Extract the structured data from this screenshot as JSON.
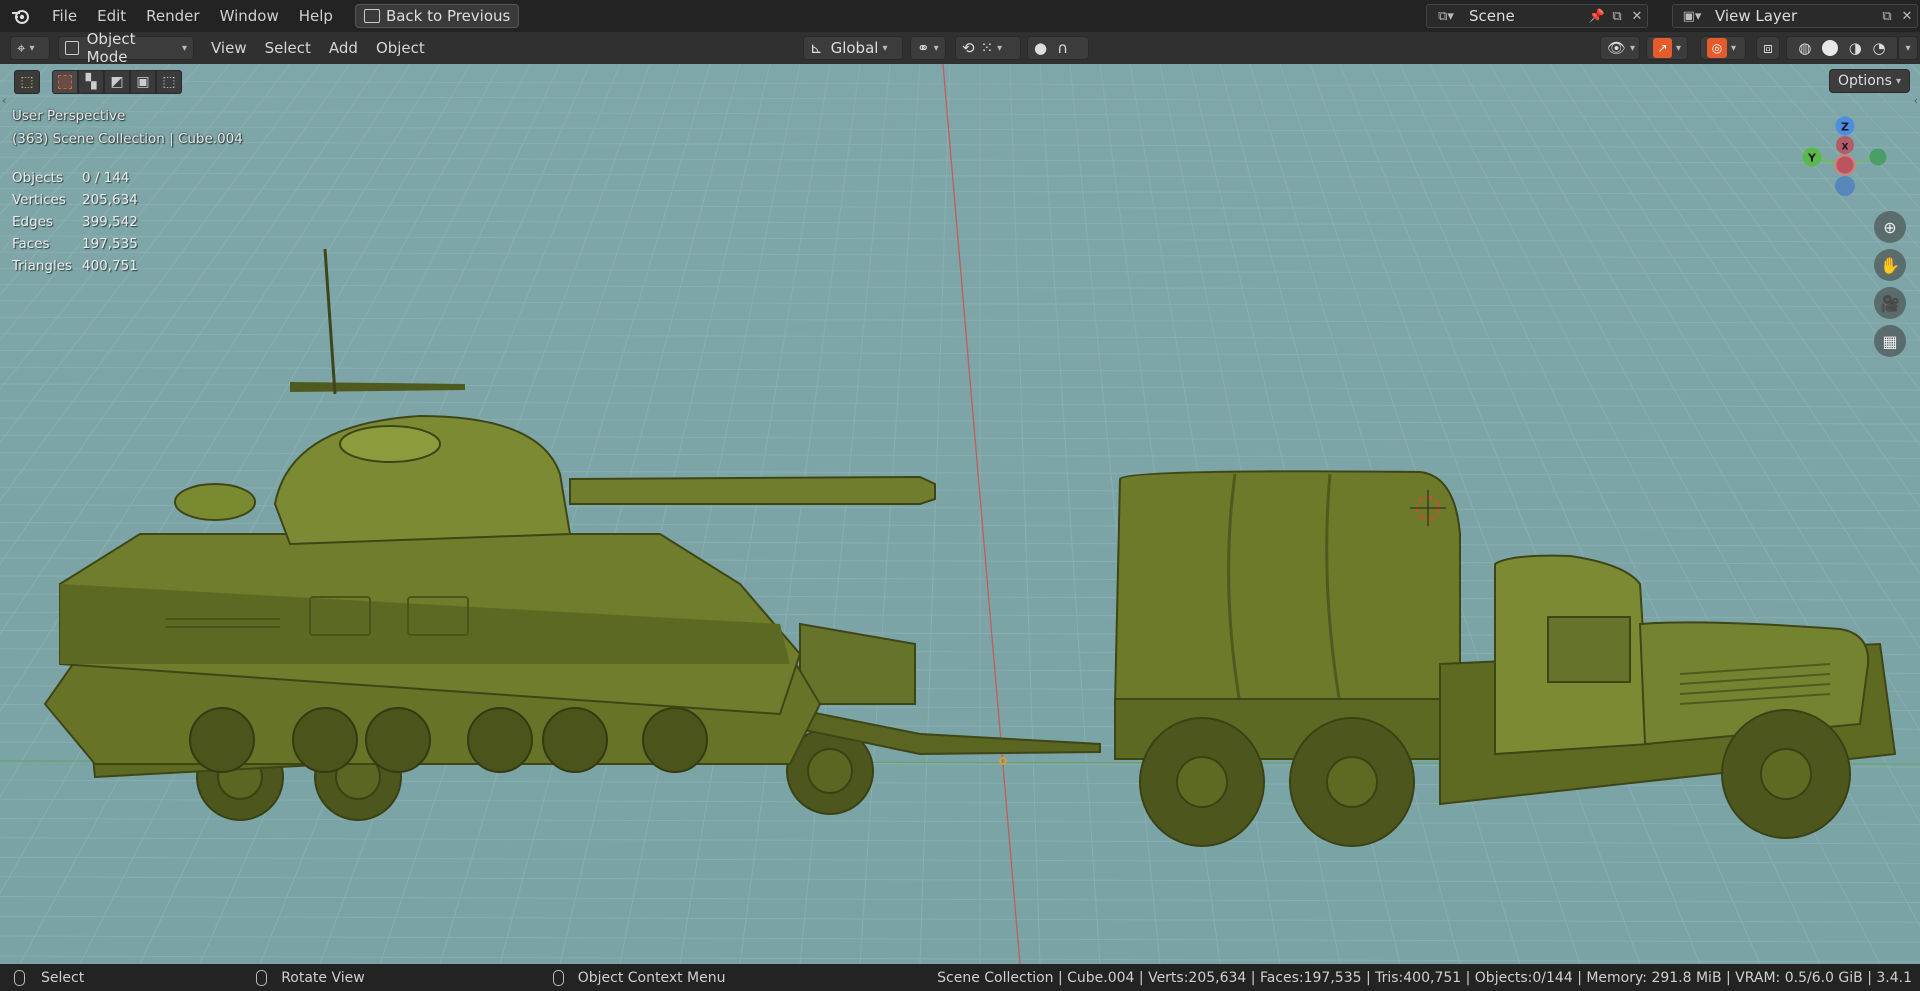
{
  "menubar": {
    "items": [
      "File",
      "Edit",
      "Render",
      "Window",
      "Help"
    ],
    "back_button": "Back to Previous",
    "scene_label": "Scene",
    "view_layer_label": "View Layer"
  },
  "header": {
    "mode": "Object Mode",
    "menus": [
      "View",
      "Select",
      "Add",
      "Object"
    ],
    "transform_orientation": "Global"
  },
  "viewport": {
    "view_name": "User Perspective",
    "collection_info": "(363) Scene Collection | Cube.004",
    "stats": [
      {
        "label": "Objects",
        "value": "0 / 144"
      },
      {
        "label": "Vertices",
        "value": "205,634"
      },
      {
        "label": "Edges",
        "value": "399,542"
      },
      {
        "label": "Faces",
        "value": "197,535"
      },
      {
        "label": "Triangles",
        "value": "400,751"
      }
    ],
    "options_label": "Options",
    "gizmo": {
      "z": "Z",
      "y": "Y",
      "x": "X"
    }
  },
  "statusbar": {
    "select": "Select",
    "rotate": "Rotate View",
    "context": "Object Context Menu",
    "info": "Scene Collection | Cube.004 | Verts:205,634 | Faces:197,535 | Tris:400,751 | Objects:0/144 | Memory: 291.8 MiB | VRAM: 0.5/6.0 GiB | 3.4.1"
  },
  "colors": {
    "accent": "#e65b2c",
    "model": "#6d7a2c",
    "viewport_bg": "#7fa6a8"
  }
}
